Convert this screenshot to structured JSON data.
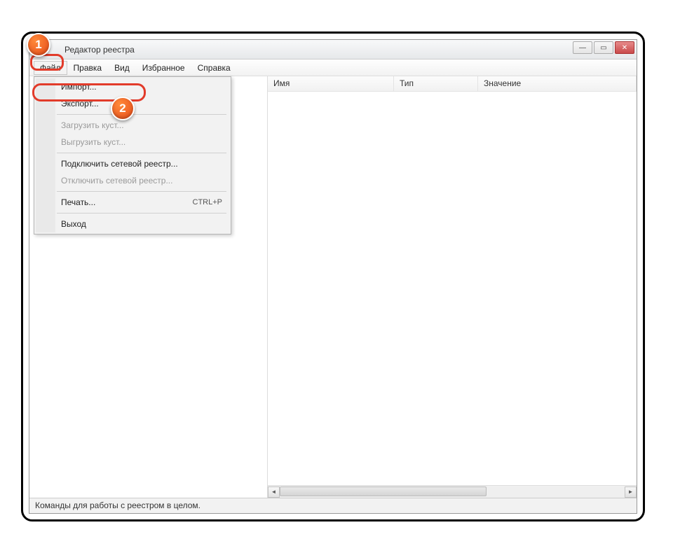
{
  "window": {
    "title": "Редактор реестра"
  },
  "menubar": {
    "file": "Файл",
    "edit": "Правка",
    "view": "Вид",
    "favorites": "Избранное",
    "help": "Справка"
  },
  "dropdown": {
    "import": "Импорт...",
    "export": "Экспорт...",
    "load_hive": "Загрузить куст...",
    "unload_hive": "Выгрузить куст...",
    "connect": "Подключить сетевой реестр...",
    "disconnect": "Отключить сетевой реестр...",
    "print": "Печать...",
    "print_shortcut": "CTRL+P",
    "exit": "Выход"
  },
  "columns": {
    "name": "Имя",
    "type": "Тип",
    "value": "Значение"
  },
  "statusbar": {
    "text": "Команды для работы с реестром в целом."
  },
  "callouts": {
    "one": "1",
    "two": "2"
  }
}
